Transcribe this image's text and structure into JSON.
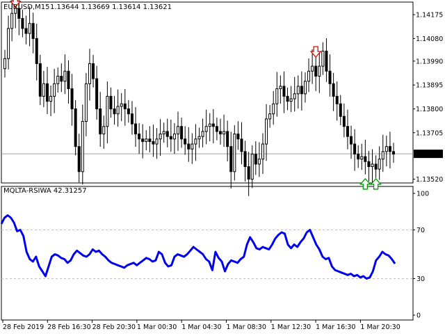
{
  "main_panel": {
    "symbol_text": "EURUSD,M15",
    "ohlc_text": "1.13644 1.13669 1.13614 1.13621",
    "price_ticks": [
      "1.14175",
      "1.14080",
      "1.13990",
      "1.13895",
      "1.13800",
      "1.13705",
      "1.13520"
    ],
    "current_price_label": "1.13621"
  },
  "indicator_panel": {
    "title_text": "MQLTA-RSIWA 42.31257",
    "level_ticks": [
      "100",
      "70",
      "30",
      "0"
    ]
  },
  "time_axis": {
    "labels": [
      "28 Feb 2019",
      "28 Feb 16:30",
      "28 Feb 20:30",
      "1 Mar 00:30",
      "1 Mar 04:30",
      "1 Mar 08:30",
      "1 Mar 12:30",
      "1 Mar 16:30",
      "1 Mar 20:30"
    ]
  },
  "colors": {
    "bull_candle": "#ffffff",
    "bear_candle": "#000000",
    "wick": "#000000",
    "rsi_line": "#0000ee",
    "sell_arrow": "#ee0000",
    "buy_arrow": "#00a000",
    "grid_dashed": "#c0c0c0",
    "axis": "#000000"
  },
  "chart_data": [
    {
      "type": "candlestick",
      "title": "EURUSD,M15",
      "ylim": [
        1.13505,
        1.14225
      ],
      "x": [
        "28 Feb 2019",
        "28 Feb 16:30",
        "28 Feb 20:30",
        "1 Mar 00:30",
        "1 Mar 04:30",
        "1 Mar 08:30",
        "1 Mar 12:30",
        "1 Mar 16:30",
        "1 Mar 20:30"
      ],
      "close": [
        1.14,
        1.1412,
        1.1418,
        1.142,
        1.1416,
        1.1412,
        1.141,
        1.1414,
        1.1408,
        1.1398,
        1.1385,
        1.139,
        1.1383,
        1.1385,
        1.139,
        1.1393,
        1.1391,
        1.1395,
        1.1388,
        1.138,
        1.1365,
        1.1355,
        1.1375,
        1.139,
        1.1398,
        1.1392,
        1.138,
        1.137,
        1.1373,
        1.1385,
        1.138,
        1.1378,
        1.1381,
        1.1382,
        1.138,
        1.1378,
        1.1374,
        1.137,
        1.1368,
        1.1367,
        1.1368,
        1.1367,
        1.1366,
        1.1368,
        1.137,
        1.1371,
        1.1369,
        1.1368,
        1.137,
        1.1373,
        1.1368,
        1.1366,
        1.1364,
        1.1366,
        1.1368,
        1.1369,
        1.1371,
        1.1373,
        1.1374,
        1.1373,
        1.1371,
        1.137,
        1.1371,
        1.1365,
        1.1355,
        1.137,
        1.1368,
        1.1363,
        1.1357,
        1.1352,
        1.1362,
        1.1358,
        1.136,
        1.1366,
        1.1376,
        1.1378,
        1.1382,
        1.1388,
        1.1389,
        1.1385,
        1.1383,
        1.1384,
        1.1386,
        1.1389,
        1.1386,
        1.1391,
        1.1395,
        1.1397,
        1.1393,
        1.1397,
        1.1403,
        1.1395,
        1.139,
        1.1385,
        1.1382,
        1.1377,
        1.1373,
        1.1369,
        1.1366,
        1.1362,
        1.136,
        1.1361,
        1.1359,
        1.1357,
        1.1358,
        1.1356,
        1.136,
        1.1363,
        1.1365,
        1.1363,
        1.1362
      ],
      "markers": [
        {
          "type": "sell",
          "index": 3,
          "price": 1.1422
        },
        {
          "type": "sell",
          "index": 88,
          "price": 1.1402
        },
        {
          "type": "buy",
          "index": 102,
          "price": 1.13508
        },
        {
          "type": "buy",
          "index": 105,
          "price": 1.13508
        }
      ],
      "current_price": 1.13621
    },
    {
      "type": "line",
      "title": "MQLTA-RSIWA 42.31257",
      "ylim": [
        0,
        100
      ],
      "levels": [
        70,
        30
      ],
      "series": [
        {
          "name": "MQLTA-RSIWA",
          "values": [
            75,
            80,
            82,
            80,
            76,
            69,
            70,
            65,
            52,
            46,
            44,
            48,
            40,
            36,
            32,
            40,
            48,
            50,
            49,
            47,
            46,
            43,
            45,
            50,
            53,
            51,
            49,
            48,
            50,
            54,
            52,
            53,
            50,
            48,
            45,
            43,
            42,
            41,
            40,
            39,
            41,
            42,
            43,
            41,
            43,
            45,
            47,
            46,
            44,
            45,
            52,
            50,
            43,
            40,
            41,
            48,
            50,
            49,
            48,
            50,
            53,
            56,
            54,
            52,
            50,
            46,
            44,
            37,
            52,
            47,
            44,
            36,
            42,
            45,
            44,
            43,
            46,
            48,
            58,
            64,
            60,
            55,
            54,
            56,
            55,
            54,
            58,
            63,
            66,
            68,
            67,
            58,
            55,
            58,
            56,
            60,
            63,
            68,
            70,
            64,
            58,
            54,
            48,
            46,
            47,
            40,
            37,
            36,
            35,
            34,
            33,
            34,
            32,
            33,
            31,
            32,
            30,
            31,
            36,
            45,
            48,
            52,
            50,
            49,
            46,
            42.31
          ]
        }
      ]
    }
  ]
}
